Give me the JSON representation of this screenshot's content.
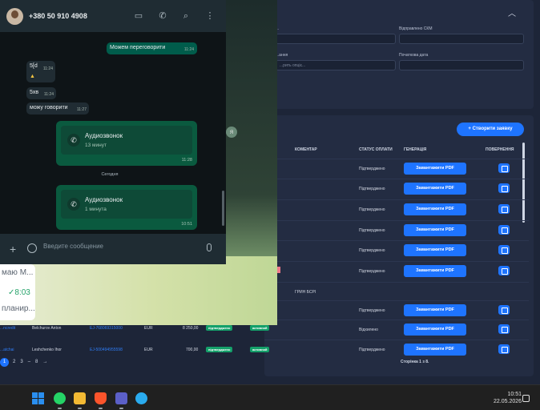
{
  "crm": {
    "top_panel": {
      "field_labels": [
        "...",
        "Відправлено СКМ",
        "...ання",
        "Початкова дата"
      ],
      "select_placeholder": "...рить опціє..."
    },
    "table": {
      "create_button": "+ Створити заявку",
      "headers": [
        "КОМЕНТАР",
        "СТАТУС ОПЛАТИ",
        "ГЕНЕРАЦІЯ",
        "ПОВЕРНЕННЯ"
      ],
      "rows": [
        {
          "pay_status": "Підтверджено",
          "pdf": "Завантажити PDF"
        },
        {
          "pay_status": "Підтверджено",
          "pdf": "Завантажити PDF"
        },
        {
          "pay_status": "Підтверджено",
          "pdf": "Завантажити PDF"
        },
        {
          "pay_status": "Підтверджено",
          "pdf": "Завантажити PDF"
        },
        {
          "pay_status": "Підтверджено",
          "pdf": "Завантажити PDF"
        },
        {
          "pay_status": "Підтверджено",
          "pdf": "Завантажити PDF"
        },
        {
          "comment": "ГРИН БСРІ"
        },
        {
          "pay_status": "Підтверджено",
          "pdf": "Завантажити PDF"
        },
        {
          "pay_status": "Відхилено",
          "pdf": "Завантажити PDF"
        },
        {
          "pay_status": "Підтверджено",
          "pdf": "Завантажити PDF"
        }
      ],
      "left_rows": [
        {
          "c1": "...ncredit",
          "c2": "Belchurov Anton",
          "c3": "EJ-768069315000",
          "c4": "EUR",
          "c5": "8 250,00",
          "b1": "підтверджено",
          "b2": "активний"
        },
        {
          "c1": "...atchai",
          "c2": "Leshchenko Ihor",
          "c3": "EJ-500494955598",
          "c4": "EUR",
          "c5": "700,00",
          "b1": "підтверджено",
          "b2": "активний"
        }
      ],
      "pager": [
        "1",
        "2",
        "3",
        "–",
        "8",
        "→"
      ],
      "footnote": "Сторінка 1 з 8."
    }
  },
  "wa_behind": {
    "line1": "маю М...",
    "line2": "✓8:03",
    "line3": "планир..."
  },
  "whatsapp": {
    "contact": "+380 50 910 4908",
    "messages": [
      {
        "dir": "out",
        "text": "Можем переговорити",
        "time": "11:24"
      },
      {
        "dir": "in",
        "text": "5[d",
        "time": "11:24"
      },
      {
        "dir": "in",
        "text": "5хв",
        "time": "11:24"
      },
      {
        "dir": "in",
        "text": "можу говорити",
        "time": "11:27"
      }
    ],
    "calls": [
      {
        "title": "Аудиозвонок",
        "duration": "13 минут",
        "time": "11:28"
      },
      {
        "title": "Аудиозвонок",
        "duration": "1 минута",
        "time": "10:51"
      }
    ],
    "day_separator": "Сегодня",
    "input_placeholder": "Введите сообщение"
  },
  "taskbar": {
    "time": "10:51",
    "date": "22.05.2026"
  },
  "colors": {
    "crm_bg": "#1d2538",
    "crm_accent": "#1e74ff",
    "wa_out_bubble": "#005c4b",
    "wa_header": "#1f2c33"
  }
}
